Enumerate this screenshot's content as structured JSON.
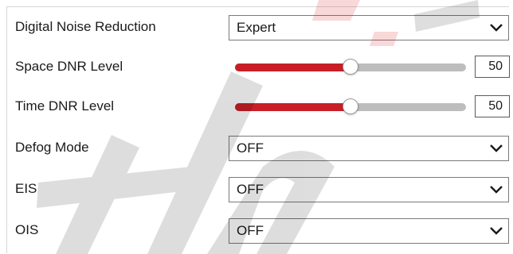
{
  "rows": {
    "dnr_mode": {
      "label": "Digital Noise Reduction",
      "value": "Expert"
    },
    "space_dnr": {
      "label": "Space DNR Level",
      "value": "50",
      "level": 0.5
    },
    "time_dnr": {
      "label": "Time DNR Level",
      "value": "50",
      "level": 0.5
    },
    "defog_mode": {
      "label": "Defog Mode",
      "value": "OFF"
    },
    "eis": {
      "label": "EIS",
      "value": "OFF"
    },
    "ois": {
      "label": "OIS",
      "value": "OFF"
    }
  },
  "icons": {
    "dropdown": "chevron-down-icon",
    "thumb": "slider-thumb"
  },
  "colors": {
    "slider_fill": "#c81e28",
    "slider_track": "#bdbdbd",
    "border": "#7a7a7a"
  }
}
